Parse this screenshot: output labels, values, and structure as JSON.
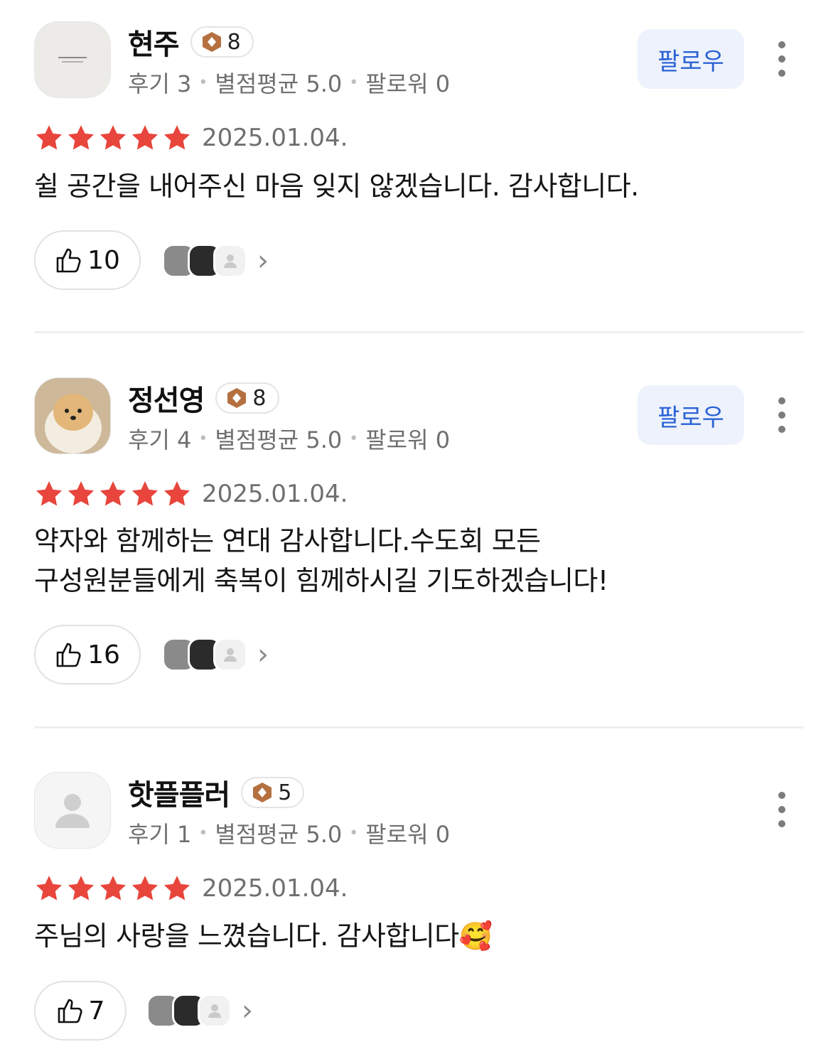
{
  "reviews": [
    {
      "user": {
        "name": "현주",
        "level": "8",
        "stats": {
          "reviews": "후기 3",
          "avg": "별점평균 5.0",
          "followers": "팔로워 0"
        }
      },
      "follow_label": "팔로우",
      "show_follow": true,
      "rating": 5,
      "date": "2025.01.04.",
      "lines": [
        "쉴 공간을 내어주신 마음 잊지 않겠습니다. 감사합니다."
      ],
      "likes": "10",
      "avatar_icon": "card-photo"
    },
    {
      "user": {
        "name": "정선영",
        "level": "8",
        "stats": {
          "reviews": "후기 4",
          "avg": "별점평균 5.0",
          "followers": "팔로워 0"
        }
      },
      "follow_label": "팔로우",
      "show_follow": true,
      "rating": 5,
      "date": "2025.01.04.",
      "lines": [
        "약자와 함께하는 연대 감사합니다.수도회 모든",
        "구성원분들에게 축복이 힘께하시길 기도하겠습니다!"
      ],
      "likes": "16",
      "avatar_icon": "dog-photo"
    },
    {
      "user": {
        "name": "핫플플러",
        "level": "5",
        "stats": {
          "reviews": "후기 1",
          "avg": "별점평균 5.0",
          "followers": "팔로워 0"
        }
      },
      "follow_label": "",
      "show_follow": false,
      "rating": 5,
      "date": "2025.01.04.",
      "lines": [
        "주님의 사랑을 느꼈습니다. 감사합니다🥰"
      ],
      "likes": "7",
      "avatar_icon": "default-user-icon"
    }
  ],
  "colors": {
    "star": "#e8453c",
    "follow_bg": "#eef2fd",
    "follow_text": "#2b63d4",
    "badge": "#b5703f"
  },
  "icons": {
    "like": "thumbs-up-icon",
    "more": "more-vertical-icon",
    "level": "level-badge-icon",
    "chevron": "chevron-right-icon"
  }
}
